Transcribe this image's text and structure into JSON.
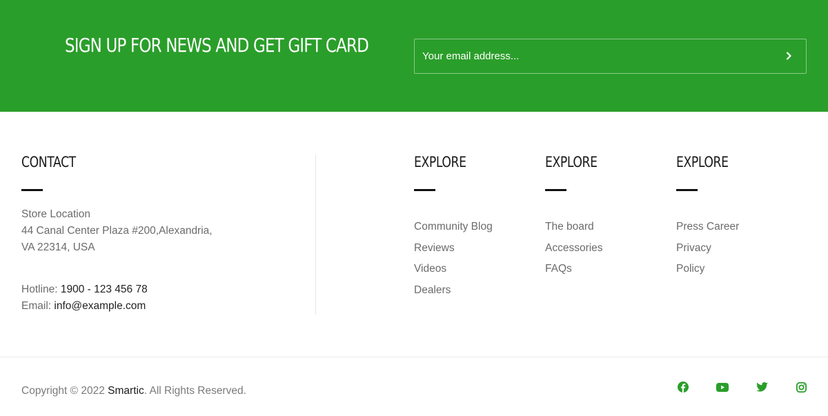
{
  "newsletter": {
    "title": "SIGN UP FOR NEWS AND GET GIFT CARD",
    "placeholder": "Your email address...",
    "submit_icon": "chevron-right-icon"
  },
  "contact": {
    "heading": "CONTACT",
    "location_label": "Store Location",
    "address_line1": "44 Canal Center Plaza #200,Alexandria,",
    "address_line2": "VA 22314, USA",
    "hotline_label": "Hotline:",
    "hotline_value": "1900 - 123 456 78",
    "email_label": "Email:",
    "email_value": "info@example.com"
  },
  "columns": [
    {
      "heading": "EXPLORE",
      "links": [
        "Community Blog",
        "Reviews",
        "Videos",
        "Dealers"
      ]
    },
    {
      "heading": "EXPLORE",
      "links": [
        "The board",
        "Accessories",
        "FAQs"
      ]
    },
    {
      "heading": "EXPLORE",
      "links": [
        "Press Career",
        "Privacy",
        "Policy"
      ]
    }
  ],
  "footer": {
    "copyright_prefix": "Copyright © 2022 ",
    "brand": "Smartic",
    "copyright_suffix": ". All Rights Reserved.",
    "social": [
      "facebook-icon",
      "youtube-icon",
      "twitter-icon",
      "instagram-icon"
    ]
  },
  "colors": {
    "accent": "#2a9e2a",
    "heading": "#1a1a1a",
    "muted_text": "#6b6b6b",
    "white": "#ffffff"
  }
}
